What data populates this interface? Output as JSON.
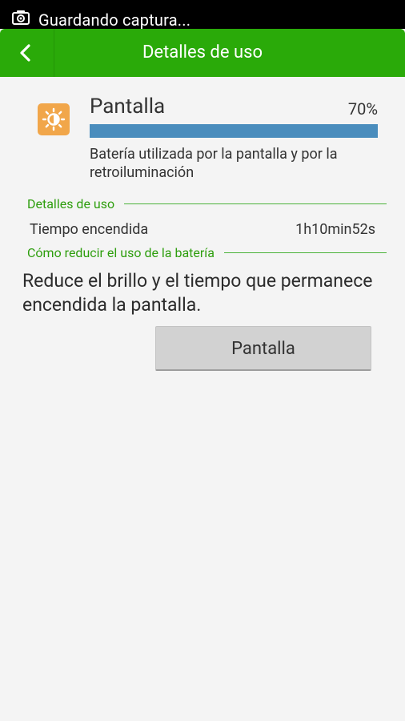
{
  "status_bar": {
    "icon": "screenshot-icon",
    "text": "Guardando captura..."
  },
  "action_bar": {
    "back_icon": "chevron-left-icon",
    "title": "Detalles de uso",
    "color": "#2aaa09"
  },
  "app": {
    "icon": "brightness-icon",
    "name": "Pantalla",
    "percent_label": "70%",
    "usage_fraction": 1.0,
    "description": "Batería utilizada por la pantalla y por la retroiluminación",
    "bar_color": "#4a8dbd"
  },
  "usage_details": {
    "header": "Detalles de uso",
    "rows": [
      {
        "label": "Tiempo encendida",
        "value": "1h10min52s"
      }
    ]
  },
  "reduce_section": {
    "header": "Cómo reducir el uso de la batería",
    "tip": "Reduce el brillo y el tiempo que permanece encendida la pantalla.",
    "button_label": "Pantalla"
  }
}
